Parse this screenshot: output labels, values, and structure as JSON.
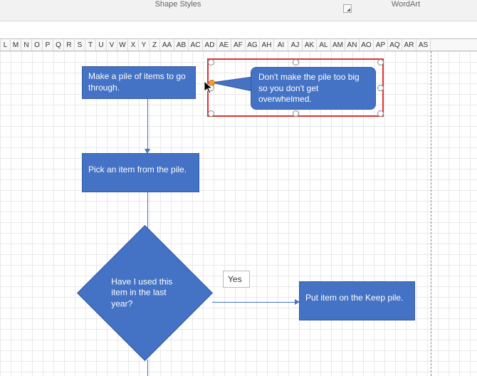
{
  "ribbon": {
    "group_left": "Shape Styles",
    "group_right": "WordArt"
  },
  "columns": [
    "L",
    "M",
    "N",
    "O",
    "P",
    "Q",
    "R",
    "S",
    "T",
    "U",
    "V",
    "W",
    "X",
    "Y",
    "Z",
    "AA",
    "AB",
    "AC",
    "AD",
    "AE",
    "AF",
    "AG",
    "AH",
    "AI",
    "AJ",
    "AK",
    "AL",
    "AM",
    "AN",
    "AO",
    "AP",
    "AQ",
    "AR",
    "AS"
  ],
  "flow": {
    "step1": "Make a pile of items to go through.",
    "callout": "Don't make the pile too big so you don't get overwhelmed.",
    "step2": "Pick an item from the pile.",
    "decision": "Have I used this item in the last year?",
    "yes_label": "Yes",
    "step_keep": "Put item on the Keep pile."
  },
  "colors": {
    "shape_fill": "#4472c4",
    "shape_border": "#375a9e",
    "selection": "#e03030",
    "grid": "#e8e8e8"
  }
}
